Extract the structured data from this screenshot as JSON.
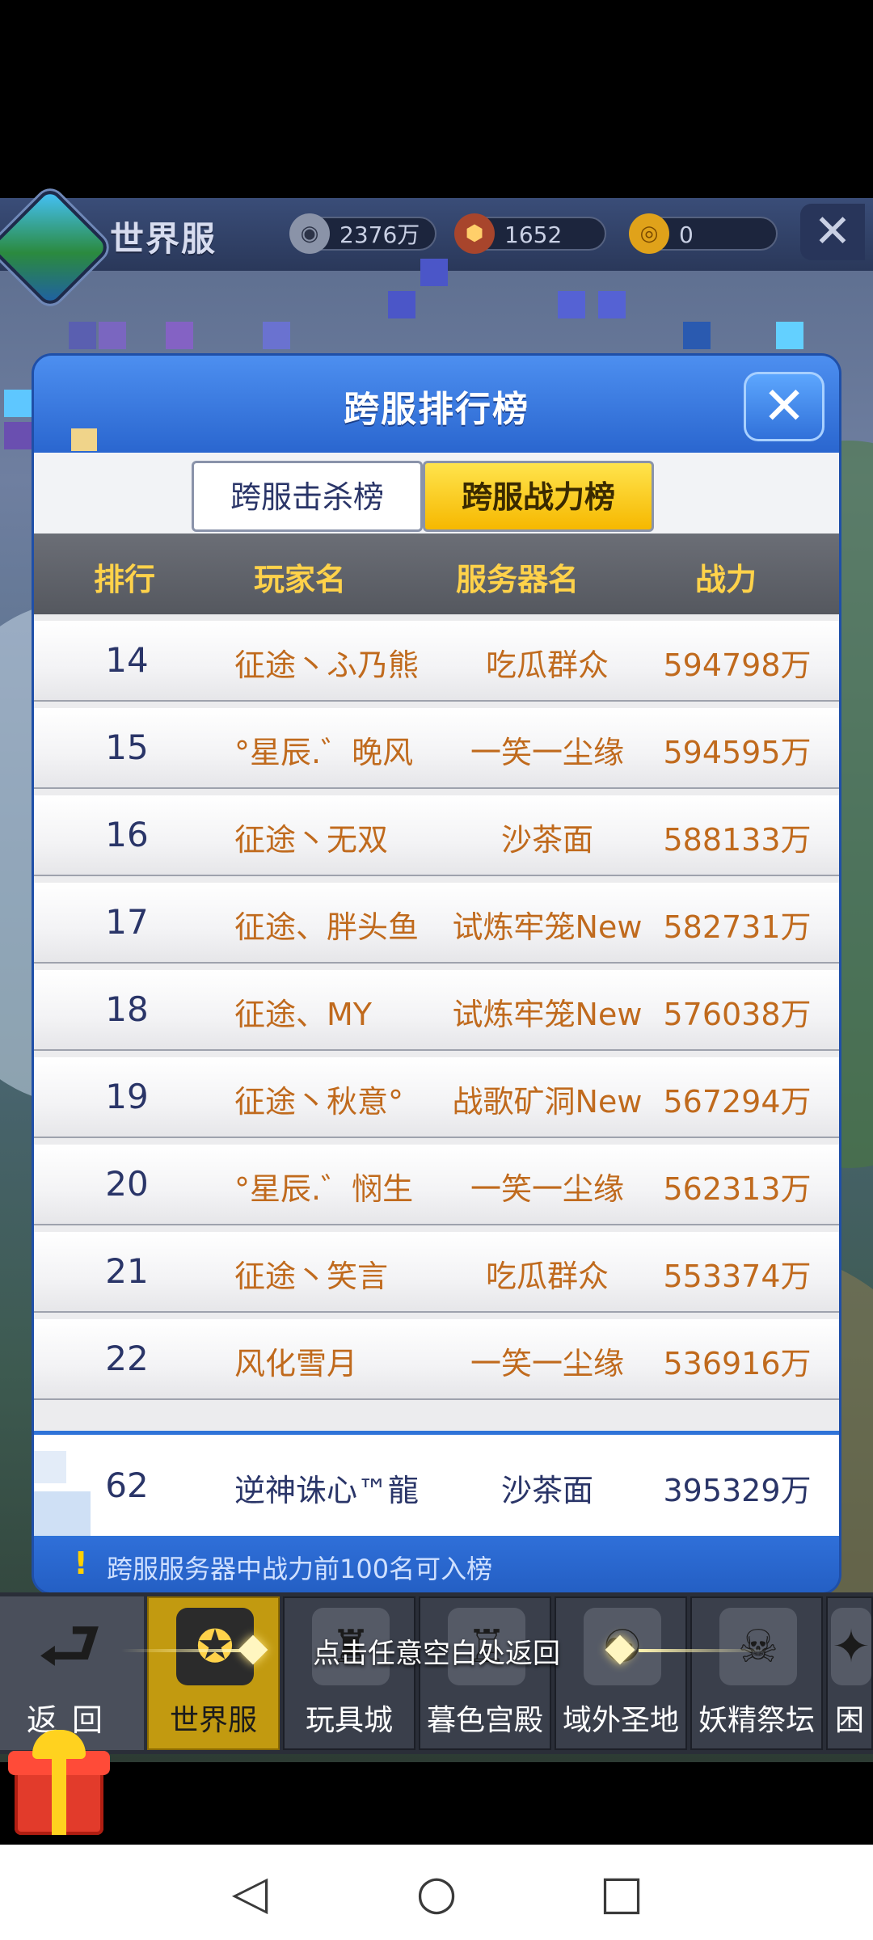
{
  "top_bar": {
    "title": "世界服",
    "resources": [
      {
        "icon": "silver-coin-icon",
        "value": "2376万"
      },
      {
        "icon": "hex-gem-icon",
        "value": "1652"
      },
      {
        "icon": "gold-coin-icon",
        "value": "0"
      }
    ],
    "close_glyph": "✕"
  },
  "panel": {
    "title": "跨服排行榜",
    "close_glyph": "✕",
    "tabs": [
      {
        "label": "跨服击杀榜",
        "active": false
      },
      {
        "label": "跨服战力榜",
        "active": true
      }
    ],
    "columns": {
      "rank": "排行",
      "player": "玩家名",
      "server": "服务器名",
      "power": "战力"
    },
    "rows": [
      {
        "rank": "14",
        "player": "征途丶ふ乃熊",
        "server": "吃瓜群众",
        "power": "594798万"
      },
      {
        "rank": "15",
        "player": "°星辰.゛晚风",
        "server": "一笑一尘缘",
        "power": "594595万"
      },
      {
        "rank": "16",
        "player": "征途丶无双",
        "server": "沙茶面",
        "power": "588133万"
      },
      {
        "rank": "17",
        "player": "征途、胖头鱼",
        "server": "试炼牢笼New",
        "power": "582731万"
      },
      {
        "rank": "18",
        "player": "征途、MY",
        "server": "试炼牢笼New",
        "power": "576038万"
      },
      {
        "rank": "19",
        "player": "征途丶秋意°",
        "server": "战歌矿洞New",
        "power": "567294万"
      },
      {
        "rank": "20",
        "player": "°星辰.゛悯生",
        "server": "一笑一尘缘",
        "power": "562313万"
      },
      {
        "rank": "21",
        "player": "征途丶笑言",
        "server": "吃瓜群众",
        "power": "553374万"
      },
      {
        "rank": "22",
        "player": "风化雪月",
        "server": "一笑一尘缘",
        "power": "536916万"
      }
    ],
    "my_row": {
      "rank": "62",
      "player": "逆神诛心™龍",
      "server": "沙茶面",
      "power": "395329万"
    },
    "footer_note": "跨服服务器中战力前100名可入榜"
  },
  "tap_hint": "点击任意空白处返回",
  "bottom_nav": {
    "back_label": "返回",
    "items": [
      {
        "label": "世界服",
        "icon": "world-server-icon",
        "active": true
      },
      {
        "label": "玩具城",
        "icon": "toy-city-icon",
        "active": false
      },
      {
        "label": "暮色宫殿",
        "icon": "twilight-palace-icon",
        "active": false
      },
      {
        "label": "域外圣地",
        "icon": "outer-sanctuary-icon",
        "active": false
      },
      {
        "label": "妖精祭坛",
        "icon": "fairy-altar-icon",
        "active": false
      },
      {
        "label": "困",
        "icon": "locked-icon",
        "active": false
      }
    ]
  },
  "colors": {
    "panel_blue": "#2f73d8",
    "tab_active_yellow": "#f6b800",
    "header_gold": "#ffd24a",
    "value_orange": "#c06a1d",
    "rank_navy": "#2a3568"
  }
}
